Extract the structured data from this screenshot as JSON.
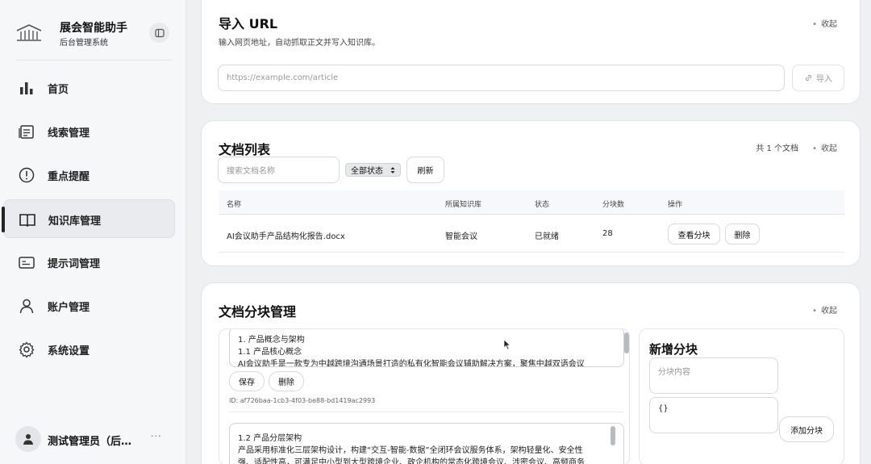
{
  "brand": {
    "title": "展会智能助手",
    "subtitle": "后台管理系统"
  },
  "nav": [
    {
      "label": "首页",
      "icon": "bar-chart-icon"
    },
    {
      "label": "线索管理",
      "icon": "document-list-icon"
    },
    {
      "label": "重点提醒",
      "icon": "alert-circle-icon"
    },
    {
      "label": "知识库管理",
      "icon": "book-icon",
      "active": true
    },
    {
      "label": "提示词管理",
      "icon": "prompt-card-icon"
    },
    {
      "label": "账户管理",
      "icon": "user-icon"
    },
    {
      "label": "系统设置",
      "icon": "gear-icon"
    }
  ],
  "user": {
    "name": "测试管理员（后…",
    "more": "···"
  },
  "import_url": {
    "title": "导入 URL",
    "collapse": "收起",
    "description": "输入网页地址，自动抓取正文并写入知识库。",
    "placeholder": "https://example.com/article",
    "button": "导入"
  },
  "doc_list": {
    "title": "文档列表",
    "count": "共 1 个文档",
    "collapse": "收起",
    "search_placeholder": "搜索文档名称",
    "status_filter": "全部状态",
    "refresh": "刷新",
    "columns": [
      "名称",
      "所属知识库",
      "状态",
      "分块数",
      "操作"
    ],
    "rows": [
      {
        "name": "AI会议助手产品结构化报告.docx",
        "kb": "智能会议",
        "status": "已就绪",
        "chunks": "28",
        "view": "查看分块",
        "delete": "删除"
      }
    ]
  },
  "chunk_mgmt": {
    "title": "文档分块管理",
    "collapse": "收起",
    "chunk1": {
      "lines": [
        "1. 产品概念与架构",
        "1.1 产品核心概念",
        "AI会议助手是一款专为中越跨境沟通场景打造的私有化智能会议辅助解决方案，聚焦中越双语会议"
      ],
      "save": "保存",
      "delete": "删除",
      "id": "ID: af726baa-1cb3-4f03-be88-bd1419ac2993"
    },
    "chunk2": {
      "lines": [
        "1.2 产品分层架构",
        "产品采用标准化三层架构设计，构建“交互-智能-数据”全闭环会议服务体系，架构轻量化、安全性",
        "强、适配性高，可满足中小型到大型跨境企业、政企机构的常态化跨境会议、涉密会议、高频商务"
      ]
    },
    "new_chunk": {
      "title": "新增分块",
      "content_placeholder": "分块内容",
      "metadata_value": "{}",
      "add_button": "添加分块"
    }
  }
}
